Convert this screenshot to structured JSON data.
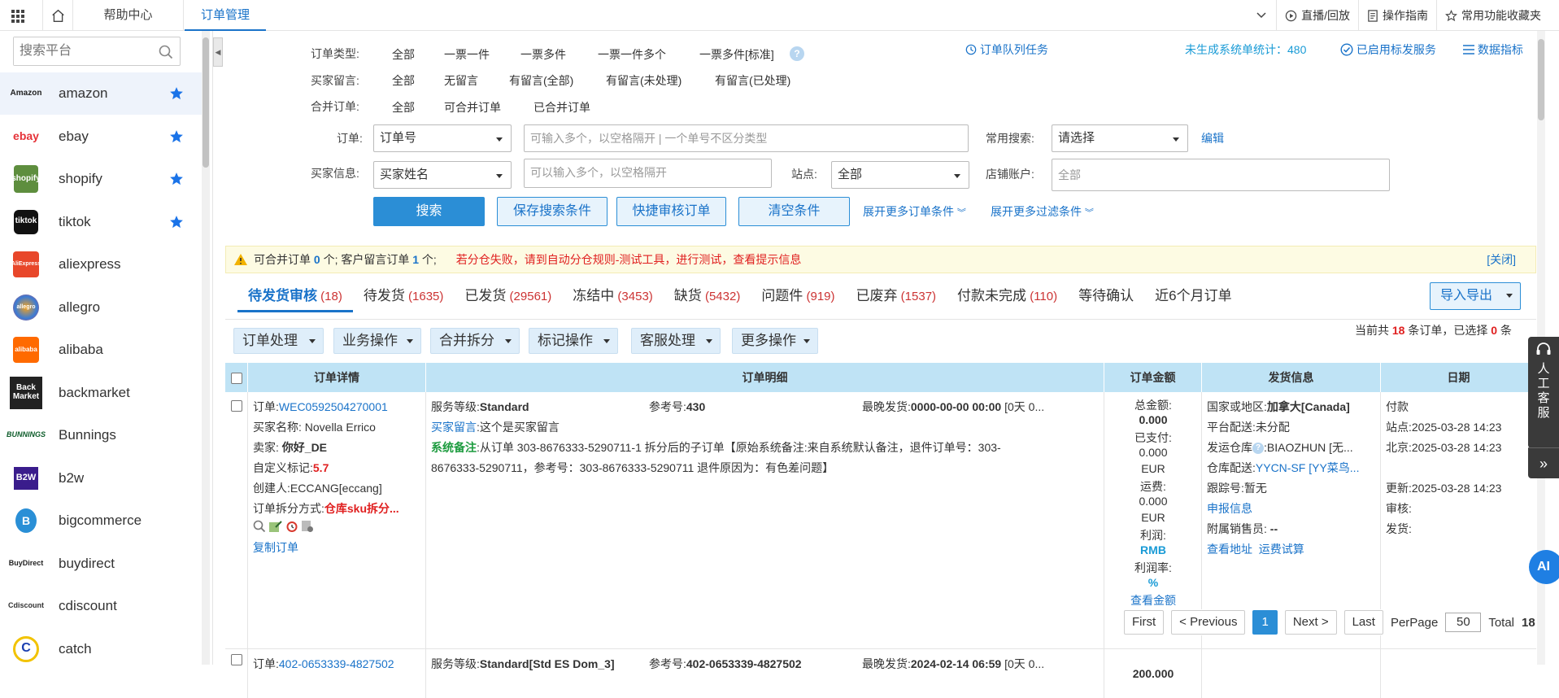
{
  "topbar": {
    "tabs": [
      "帮助中心",
      "订单管理"
    ],
    "right_items": [
      "直播/回放",
      "操作指南",
      "常用功能收藏夹"
    ]
  },
  "sidebar": {
    "search_placeholder": "搜索平台",
    "platforms": [
      {
        "name": "amazon",
        "logo": "Amazon",
        "starred": true,
        "active": true
      },
      {
        "name": "ebay",
        "logo": "ebay",
        "starred": true
      },
      {
        "name": "shopify",
        "logo": "shopify",
        "starred": true
      },
      {
        "name": "tiktok",
        "logo": "tiktok",
        "starred": true
      },
      {
        "name": "aliexpress",
        "logo": "AliExpress"
      },
      {
        "name": "allegro",
        "logo": "allegro"
      },
      {
        "name": "alibaba",
        "logo": "alibaba"
      },
      {
        "name": "backmarket",
        "logo": "Back Market"
      },
      {
        "name": "Bunnings",
        "logo": "BUNNINGS"
      },
      {
        "name": "b2w",
        "logo": "B2W"
      },
      {
        "name": "bigcommerce",
        "logo": "B"
      },
      {
        "name": "buydirect",
        "logo": "BuyDirect"
      },
      {
        "name": "cdiscount",
        "logo": "Cdiscount"
      },
      {
        "name": "catch",
        "logo": "C"
      }
    ]
  },
  "filters": {
    "order_type_label": "订单类型:",
    "order_type_options": [
      "全部",
      "一票一件",
      "一票多件",
      "一票一件多个",
      "一票多件[标准]"
    ],
    "buyer_msg_label": "买家留言:",
    "buyer_msg_options": [
      "全部",
      "无留言",
      "有留言(全部)",
      "有留言(未处理)",
      "有留言(已处理)"
    ],
    "merge_label": "合并订单:",
    "merge_options": [
      "全部",
      "可合并订单",
      "已合并订单"
    ],
    "queue_task": "订单队列任务",
    "ungenerated": "未生成系统单统计：480",
    "enabled_service": "已启用标发服务",
    "data_metrics": "数据指标",
    "order_label": "订单:",
    "order_select": "订单号",
    "order_input_placeholder": "可输入多个，以空格隔开 | 一个单号不区分类型",
    "common_search_label": "常用搜索:",
    "common_search_select": "请选择",
    "edit": "编辑",
    "buyer_info_label": "买家信息:",
    "buyer_select": "买家姓名",
    "buyer_input_placeholder": "可以输入多个，以空格隔开",
    "site_label": "站点:",
    "site_select": "全部",
    "shop_label": "店铺账户:",
    "shop_input_placeholder": "全部",
    "search_btn": "搜索",
    "save_btn": "保存搜索条件",
    "quick_review_btn": "快捷审核订单",
    "clear_btn": "清空条件",
    "more_order_cond": "展开更多订单条件",
    "more_filter_cond": "展开更多过滤条件"
  },
  "notice": {
    "a": "可合并订单 ",
    "a_count": "0",
    "b": " 个; 客户留言订单 ",
    "b_count": "1",
    "c": " 个;",
    "warning": "若分仓失败，请到自动分仓规则-测试工具，进行测试，查看提示信息",
    "close": "[关闭]"
  },
  "status_tabs": [
    {
      "label": "待发货审核",
      "count": "(18)",
      "active": true
    },
    {
      "label": "待发货",
      "count": "(1635)"
    },
    {
      "label": "已发货",
      "count": "(29561)"
    },
    {
      "label": "冻结中",
      "count": "(3453)"
    },
    {
      "label": "缺货",
      "count": "(5432)"
    },
    {
      "label": "问题件",
      "count": "(919)"
    },
    {
      "label": "已废弃",
      "count": "(1537)"
    },
    {
      "label": "付款未完成",
      "count": "(110)"
    },
    {
      "label": "等待确认",
      "count": ""
    },
    {
      "label": "近6个月订单",
      "count": ""
    }
  ],
  "export_btn": "导入导出",
  "ops": [
    "订单处理",
    "业务操作",
    "合并拆分",
    "标记操作",
    "客服处理",
    "更多操作"
  ],
  "summary": {
    "pre": "当前共 ",
    "total": "18",
    "mid": " 条订单，已选择 ",
    "selected": "0",
    "post": " 条"
  },
  "table_headers": [
    "订单详情",
    "订单明细",
    "订单金额",
    "发货信息",
    "日期"
  ],
  "rows": [
    {
      "order_label": "订单:",
      "order_no": "WEC0592504270001",
      "buyer_name": "买家名称: Novella Errico",
      "seller_label": "卖家: ",
      "seller": "你好_DE",
      "custom_label": "自定义标记:",
      "custom": "5.7",
      "creator": "创建人:ECCANG[eccang]",
      "split_label": "订单拆分方式:",
      "split": "仓库sku拆分...",
      "copy": "复制订单",
      "service_label": "服务等级:",
      "service": "Standard",
      "ref_label": "参考号:",
      "ref": "430",
      "latest_label": "最晚发货:",
      "latest": "0000-00-00 00:00",
      "latest_extra": " [0天 0...",
      "buyer_msg_label": "买家留言",
      "buyer_msg": ":这个是买家留言",
      "sys_note_label": "系统备注",
      "sys_note_1": ":从订单 303-8676333-5290711-1 拆分后的子订单【原始系统备注:来自系统默认备注，退件订单号：303-",
      "sys_note_2": "8676333-5290711，参考号：303-8676333-5290711 退件原因为：有色差问题】",
      "amount": {
        "total_label": "总金额:",
        "total": "0.000",
        "paid_label": "已支付:",
        "paid": "0.000",
        "paid_cur": "EUR",
        "ship_label": "运费:",
        "ship": "0.000",
        "ship_cur": "EUR",
        "profit_label": "利润:",
        "profit": "RMB",
        "margin_label": "利润率:",
        "margin": "%",
        "view": "查看金额"
      },
      "ship": {
        "country_label": "国家或地区:",
        "country": "加拿大[Canada]",
        "platform_label": "平台配送:",
        "platform": "未分配",
        "wh_label": "发运仓库",
        "wh": ":BIAOZHUN [无...",
        "whd_label": "仓库配送:",
        "whd": "YYCN-SF [YY菜鸟...",
        "track": "跟踪号:暂无",
        "declare": "申报信息",
        "attach_label": "附属销售员: ",
        "attach": "--",
        "view_addr": "查看地址",
        "freight": "运费试算"
      },
      "dates": {
        "pay": "付款",
        "site": "站点:2025-03-28 14:23",
        "bj": "北京:2025-03-28 14:23",
        "update": "更新:2025-03-28 14:23",
        "audit": "审核:",
        "ship": "发货:"
      }
    },
    {
      "order_label": "订单:",
      "order_no": "402-0653339-4827502",
      "service_label": "服务等级:",
      "service": "Standard[Std ES Dom_3]",
      "ref_label": "参考号:",
      "ref": "402-0653339-4827502",
      "latest_label": "最晚发货:",
      "latest": "2024-02-14 06:59",
      "latest_extra": " [0天 0...",
      "amount_partial": "200.000"
    }
  ],
  "pager": {
    "first": "First",
    "prev": "< Previous",
    "current": "1",
    "next": "Next >",
    "last": "Last",
    "per_page_label": "PerPage",
    "per_page": "50",
    "total_label": "Total",
    "total": "18"
  },
  "service_widget": "人工客服",
  "ai": "AI",
  "colors": {
    "accent": "#1a73c9",
    "primary_btn": "#2b8ed6",
    "header_bg": "#bfe3f5",
    "count_red": "#cc3333",
    "warning_red": "#e02020",
    "note_green": "#1c9b3e"
  }
}
